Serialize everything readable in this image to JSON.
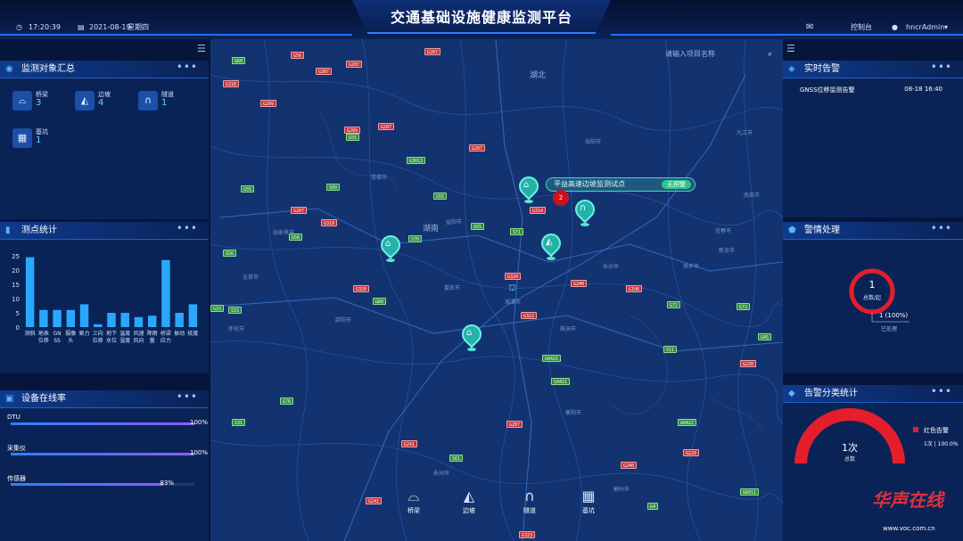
{
  "header": {
    "time": "17:20:39",
    "date": "2021-08-19",
    "weekday": "星期四",
    "title": "交通基础设施健康监测平台",
    "console_label": "控制台",
    "user": "hncrAdmin"
  },
  "colors": {
    "accent": "#2d7cff",
    "alarm_red": "#e41e2b",
    "pin_teal": "#24b1a8",
    "ok_green": "#2ec489"
  },
  "monitor_summary": {
    "title": "监测对象汇总",
    "items": [
      {
        "name": "桥梁",
        "count": "3",
        "icon": "bridge-icon"
      },
      {
        "name": "边坡",
        "count": "4",
        "icon": "slope-icon"
      },
      {
        "name": "隧道",
        "count": "1",
        "icon": "tunnel-icon"
      },
      {
        "name": "基坑",
        "count": "1",
        "icon": "pit-icon"
      }
    ]
  },
  "point_stats": {
    "title": "测点统计"
  },
  "chart_data": {
    "type": "bar",
    "title": "",
    "xlabel": "",
    "ylabel": "",
    "ylim": [
      0,
      25
    ],
    "yticks": [
      "0",
      "5",
      "10",
      "15",
      "20",
      "25"
    ],
    "categories": [
      "测斜",
      "地表位移",
      "GNSS",
      "摄像头",
      "索力",
      "三向位移",
      "地下水位",
      "温度湿度",
      "风速风向",
      "降雨量",
      "桥梁应力",
      "振动",
      "挠度"
    ],
    "tick_labels": [
      [
        "测斜"
      ],
      [
        "地表",
        "位移"
      ],
      [
        "GN",
        "SS"
      ],
      [
        "摄像",
        "头"
      ],
      [
        "索力"
      ],
      [
        "三向",
        "位移"
      ],
      [
        "地下",
        "水位"
      ],
      [
        "温度",
        "湿度"
      ],
      [
        "风速",
        "风向"
      ],
      [
        "降雨",
        "量"
      ],
      [
        "桥梁",
        "应力"
      ],
      [
        "振动"
      ],
      [
        "挠度"
      ]
    ],
    "values": [
      24.5,
      6,
      6,
      6,
      8,
      1,
      5,
      5,
      3.5,
      4,
      23.5,
      5,
      8
    ],
    "color": "#2aa8ff"
  },
  "device_online": {
    "title": "设备在线率",
    "rows": [
      {
        "label": "DTU",
        "pct": "100%",
        "value": 1.0
      },
      {
        "label": "采集仪",
        "pct": "100%",
        "value": 1.0
      },
      {
        "label": "传感器",
        "pct": "83%",
        "value": 0.83
      }
    ]
  },
  "realtime_alarm": {
    "title": "实时告警",
    "items": [
      {
        "name": "GNSS位移监测告警",
        "time": "08-18 16:40"
      }
    ]
  },
  "alarm_handling": {
    "title": "警情处理",
    "total": "1",
    "total_label": "总数/起",
    "handled": "1 (100%)",
    "handled_label": "已处理"
  },
  "alarm_category": {
    "title": "告警分类统计",
    "value": "1次",
    "value_label": "总数",
    "legend": "红色告警",
    "legend_detail": "1次 | 100.0%"
  },
  "map": {
    "search_placeholder": "请输入项目名称",
    "popup_text": "平益高速边坡监测试点",
    "popup_tag": "无预警",
    "cluster_count": "2",
    "province_label": "湖南",
    "north_label": "湖北",
    "city_labels": [
      "岳阳市",
      "常德市",
      "益阳市",
      "长沙市",
      "湘潭市",
      "株洲市",
      "娄底市",
      "邵阳市",
      "衡阳市",
      "永州市",
      "郴州市",
      "怀化市",
      "张家界市",
      "吉首市",
      "萍乡市",
      "新余市",
      "宜春市",
      "九江市",
      "南昌市"
    ],
    "categories": [
      "桥梁",
      "边坡",
      "隧道",
      "基坑"
    ]
  },
  "watermark": {
    "logo": "华声在线",
    "url": "www.voc.com.cn"
  }
}
